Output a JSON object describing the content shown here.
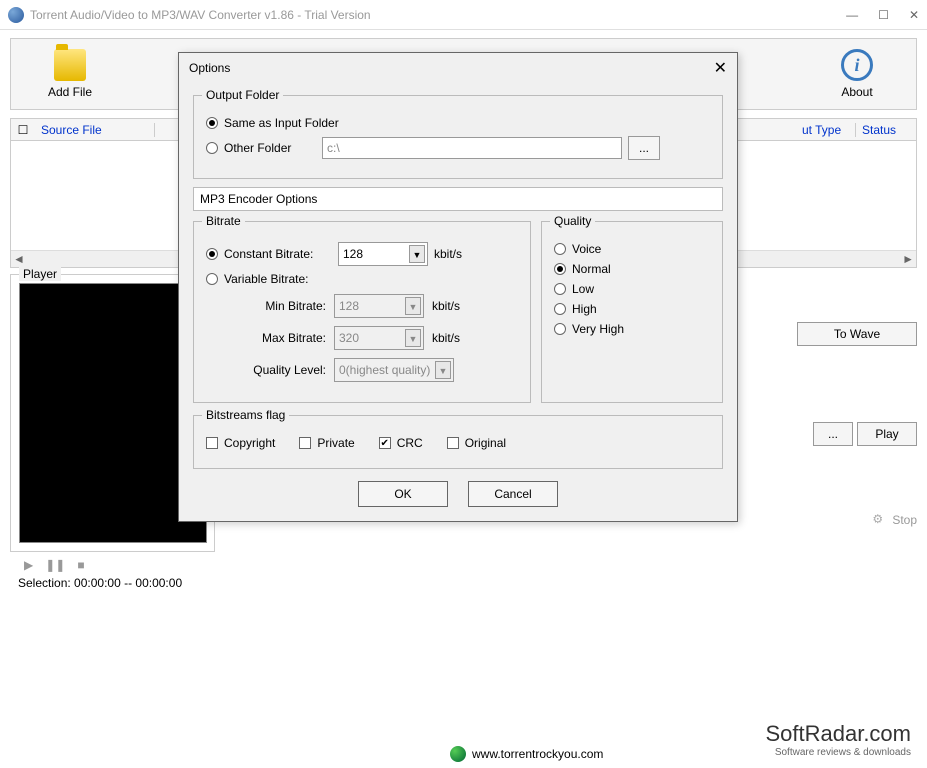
{
  "window": {
    "title": "Torrent Audio/Video to MP3/WAV Converter v1.86 - Trial Version"
  },
  "toolbar": {
    "addfile": "Add File",
    "about": "About"
  },
  "columns": {
    "source": "Source File",
    "outtype": "ut Type",
    "status": "Status"
  },
  "player": {
    "label": "Player",
    "selection": "Selection: 00:00:00 -- 00:00:00"
  },
  "right": {
    "towave": "To Wave",
    "browse": "...",
    "play": "Play",
    "stop": "Stop"
  },
  "footer": {
    "url": "www.torrentrockyou.com",
    "brand": "SoftRadar.com",
    "sub": "Software reviews & downloads"
  },
  "dialog": {
    "title": "Options",
    "outputFolder": {
      "legend": "Output Folder",
      "same": "Same as Input Folder",
      "other": "Other Folder",
      "path": "c:\\",
      "browse": "..."
    },
    "encoderSection": "MP3 Encoder Options",
    "bitrate": {
      "legend": "Bitrate",
      "constant": "Constant Bitrate:",
      "variable": "Variable Bitrate:",
      "minLabel": "Min Bitrate:",
      "maxLabel": "Max Bitrate:",
      "qlabel": "Quality Level:",
      "cval": "128",
      "minval": "128",
      "maxval": "320",
      "qval": "0(highest quality)",
      "unit": "kbit/s"
    },
    "quality": {
      "legend": "Quality",
      "voice": "Voice",
      "normal": "Normal",
      "low": "Low",
      "high": "High",
      "vhigh": "Very High"
    },
    "bitstream": {
      "legend": "Bitstreams flag",
      "copyright": "Copyright",
      "private": "Private",
      "crc": "CRC",
      "original": "Original"
    },
    "ok": "OK",
    "cancel": "Cancel"
  }
}
